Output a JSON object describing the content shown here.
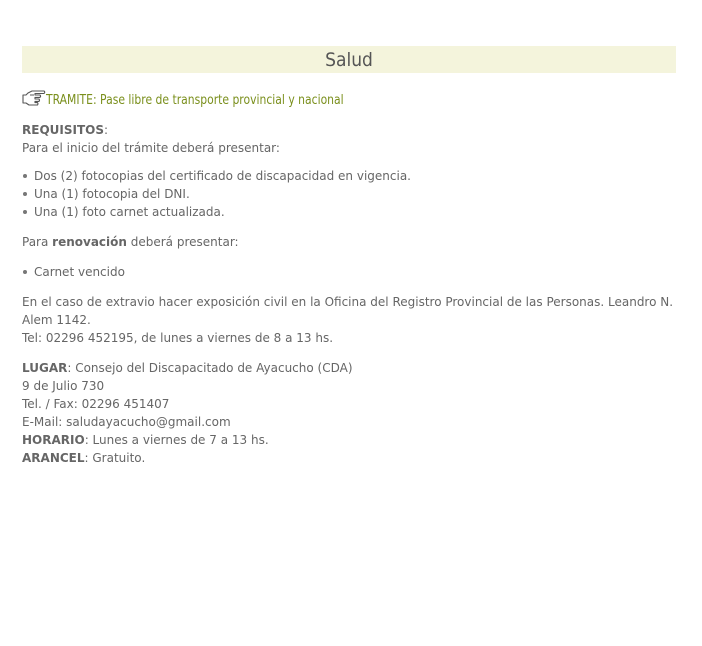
{
  "title": "Salud",
  "tramite": "TRAMITE: Pase libre de transporte provincial y nacional",
  "requisitos": {
    "label": "REQUISITOS",
    "suffix": ":",
    "intro": "Para el inicio del trámite deberá presentar:",
    "items": [
      "Dos (2) fotocopias del certificado de discapacidad en vigencia.",
      "Una (1) fotocopia del DNI.",
      "Una (1) foto carnet actualizada."
    ]
  },
  "renovacion": {
    "prefix": "Para ",
    "bold": "renovación",
    "suffix": " deberá presentar:",
    "items": [
      "Carnet vencido"
    ]
  },
  "extravio": {
    "line1": "En el caso de extravio hacer exposición civil en la Oficina del Registro Provincial de las Personas. Leandro N. Alem 1142.",
    "line2": "Tel: 02296 452195, de lunes a viernes de 8 a 13 hs."
  },
  "lugar": {
    "label": "LUGAR",
    "value": ": Consejo del Discapacitado de Ayacucho (CDA)",
    "address": "9 de Julio 730",
    "phone": "Tel. / Fax: 02296 451407",
    "email": "E-Mail: saludayacucho@gmail.com"
  },
  "horario": {
    "label": "HORARIO",
    "value": ": Lunes a viernes de 7 a 13 hs."
  },
  "arancel": {
    "label": "ARANCEL",
    "value": ": Gratuito."
  },
  "icons": {
    "tramite": "pointing-hand-icon",
    "bullet": "bullet-dot-icon"
  }
}
